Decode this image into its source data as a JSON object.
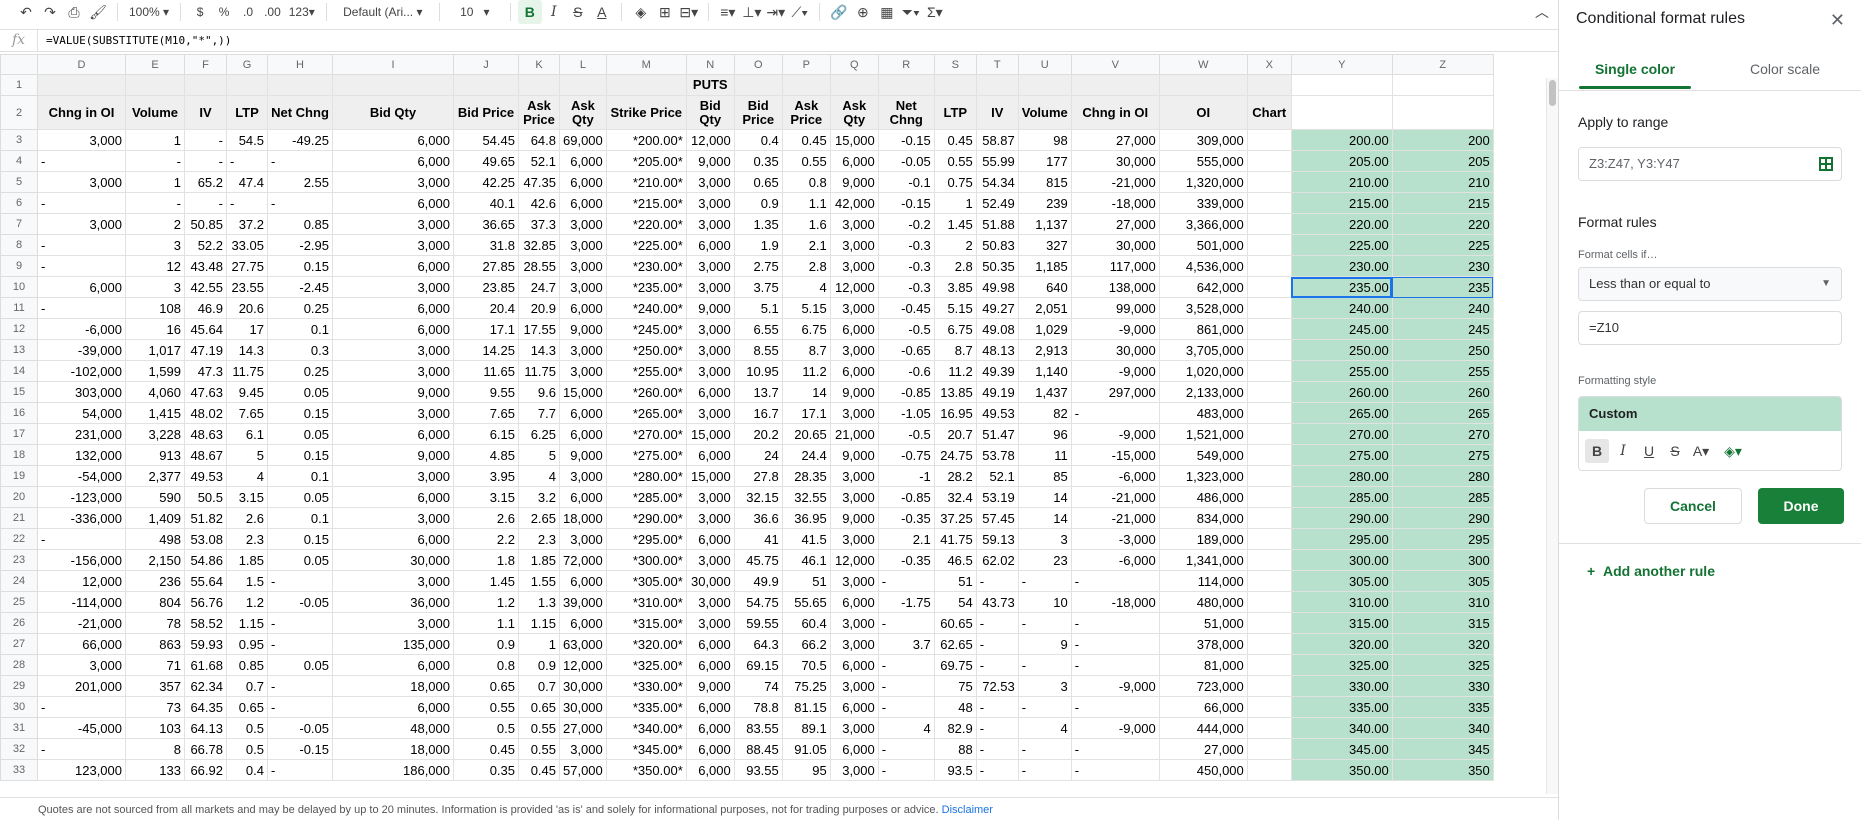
{
  "toolbar": {
    "zoom": "100%",
    "currency": "$",
    "percent": "%",
    "dec_less": ".0",
    "dec_more": ".00",
    "format_more": "123",
    "font": "Default (Ari...",
    "font_size": "10"
  },
  "formula": "=VALUE(SUBSTITUTE(M10,\"*\",))",
  "columns": [
    "D",
    "E",
    "F",
    "G",
    "H",
    "I",
    "J",
    "K",
    "L",
    "M",
    "N",
    "O",
    "P",
    "Q",
    "R",
    "S",
    "T",
    "U",
    "V",
    "W",
    "X",
    "Y",
    "Z"
  ],
  "puts_label": "PUTS",
  "headers": [
    "Chng in OI",
    "Volume",
    "IV",
    "LTP",
    "Net Chng",
    "Bid Qty",
    "Bid Price",
    "Ask Price",
    "Ask Qty",
    "Strike Price",
    "Bid Qty",
    "Bid Price",
    "Ask Price",
    "Ask Qty",
    "Net Chng",
    "LTP",
    "IV",
    "Volume",
    "Chng in OI",
    "OI",
    "Chart"
  ],
  "rows": [
    [
      "3",
      "3,000",
      "1",
      "-",
      "54.5",
      "-49.25",
      "6,000",
      "54.45",
      "64.8",
      "69,000",
      "*200.00*",
      "12,000",
      "0.4",
      "0.45",
      "15,000",
      "-0.15",
      "0.45",
      "58.87",
      "98",
      "27,000",
      "309,000",
      "",
      "200.00",
      "200"
    ],
    [
      "4",
      "-",
      "-",
      "-",
      "-",
      "-",
      "6,000",
      "49.65",
      "52.1",
      "6,000",
      "*205.00*",
      "9,000",
      "0.35",
      "0.55",
      "6,000",
      "-0.05",
      "0.55",
      "55.99",
      "177",
      "30,000",
      "555,000",
      "",
      "205.00",
      "205"
    ],
    [
      "5",
      "3,000",
      "1",
      "65.2",
      "47.4",
      "2.55",
      "3,000",
      "42.25",
      "47.35",
      "6,000",
      "*210.00*",
      "3,000",
      "0.65",
      "0.8",
      "9,000",
      "-0.1",
      "0.75",
      "54.34",
      "815",
      "-21,000",
      "1,320,000",
      "",
      "210.00",
      "210"
    ],
    [
      "6",
      "-",
      "-",
      "-",
      "-",
      "-",
      "6,000",
      "40.1",
      "42.6",
      "6,000",
      "*215.00*",
      "3,000",
      "0.9",
      "1.1",
      "42,000",
      "-0.15",
      "1",
      "52.49",
      "239",
      "-18,000",
      "339,000",
      "",
      "215.00",
      "215"
    ],
    [
      "7",
      "3,000",
      "2",
      "50.85",
      "37.2",
      "0.85",
      "3,000",
      "36.65",
      "37.3",
      "3,000",
      "*220.00*",
      "3,000",
      "1.35",
      "1.6",
      "3,000",
      "-0.2",
      "1.45",
      "51.88",
      "1,137",
      "27,000",
      "3,366,000",
      "",
      "220.00",
      "220"
    ],
    [
      "8",
      "-",
      "3",
      "52.2",
      "33.05",
      "-2.95",
      "3,000",
      "31.8",
      "32.85",
      "3,000",
      "*225.00*",
      "6,000",
      "1.9",
      "2.1",
      "3,000",
      "-0.3",
      "2",
      "50.83",
      "327",
      "30,000",
      "501,000",
      "",
      "225.00",
      "225"
    ],
    [
      "9",
      "-",
      "12",
      "43.48",
      "27.75",
      "0.15",
      "6,000",
      "27.85",
      "28.55",
      "3,000",
      "*230.00*",
      "3,000",
      "2.75",
      "2.8",
      "3,000",
      "-0.3",
      "2.8",
      "50.35",
      "1,185",
      "117,000",
      "4,536,000",
      "",
      "230.00",
      "230"
    ],
    [
      "10",
      "6,000",
      "3",
      "42.55",
      "23.55",
      "-2.45",
      "3,000",
      "23.85",
      "24.7",
      "3,000",
      "*235.00*",
      "3,000",
      "3.75",
      "4",
      "12,000",
      "-0.3",
      "3.85",
      "49.98",
      "640",
      "138,000",
      "642,000",
      "",
      "235.00",
      "235"
    ],
    [
      "11",
      "-",
      "108",
      "46.9",
      "20.6",
      "0.25",
      "6,000",
      "20.4",
      "20.9",
      "6,000",
      "*240.00*",
      "9,000",
      "5.1",
      "5.15",
      "3,000",
      "-0.45",
      "5.15",
      "49.27",
      "2,051",
      "99,000",
      "3,528,000",
      "",
      "240.00",
      "240"
    ],
    [
      "12",
      "-6,000",
      "16",
      "45.64",
      "17",
      "0.1",
      "6,000",
      "17.1",
      "17.55",
      "9,000",
      "*245.00*",
      "3,000",
      "6.55",
      "6.75",
      "6,000",
      "-0.5",
      "6.75",
      "49.08",
      "1,029",
      "-9,000",
      "861,000",
      "",
      "245.00",
      "245"
    ],
    [
      "13",
      "-39,000",
      "1,017",
      "47.19",
      "14.3",
      "0.3",
      "3,000",
      "14.25",
      "14.3",
      "3,000",
      "*250.00*",
      "3,000",
      "8.55",
      "8.7",
      "3,000",
      "-0.65",
      "8.7",
      "48.13",
      "2,913",
      "30,000",
      "3,705,000",
      "",
      "250.00",
      "250"
    ],
    [
      "14",
      "-102,000",
      "1,599",
      "47.3",
      "11.75",
      "0.25",
      "3,000",
      "11.65",
      "11.75",
      "3,000",
      "*255.00*",
      "3,000",
      "10.95",
      "11.2",
      "6,000",
      "-0.6",
      "11.2",
      "49.39",
      "1,140",
      "-9,000",
      "1,020,000",
      "",
      "255.00",
      "255"
    ],
    [
      "15",
      "303,000",
      "4,060",
      "47.63",
      "9.45",
      "0.05",
      "9,000",
      "9.55",
      "9.6",
      "15,000",
      "*260.00*",
      "6,000",
      "13.7",
      "14",
      "9,000",
      "-0.85",
      "13.85",
      "49.19",
      "1,437",
      "297,000",
      "2,133,000",
      "",
      "260.00",
      "260"
    ],
    [
      "16",
      "54,000",
      "1,415",
      "48.02",
      "7.65",
      "0.15",
      "3,000",
      "7.65",
      "7.7",
      "6,000",
      "*265.00*",
      "3,000",
      "16.7",
      "17.1",
      "3,000",
      "-1.05",
      "16.95",
      "49.53",
      "82",
      "-",
      "483,000",
      "",
      "265.00",
      "265"
    ],
    [
      "17",
      "231,000",
      "3,228",
      "48.63",
      "6.1",
      "0.05",
      "6,000",
      "6.15",
      "6.25",
      "6,000",
      "*270.00*",
      "15,000",
      "20.2",
      "20.65",
      "21,000",
      "-0.5",
      "20.7",
      "51.47",
      "96",
      "-9,000",
      "1,521,000",
      "",
      "270.00",
      "270"
    ],
    [
      "18",
      "132,000",
      "913",
      "48.67",
      "5",
      "0.15",
      "9,000",
      "4.85",
      "5",
      "9,000",
      "*275.00*",
      "6,000",
      "24",
      "24.4",
      "9,000",
      "-0.75",
      "24.75",
      "53.78",
      "11",
      "-15,000",
      "549,000",
      "",
      "275.00",
      "275"
    ],
    [
      "19",
      "-54,000",
      "2,377",
      "49.53",
      "4",
      "0.1",
      "3,000",
      "3.95",
      "4",
      "3,000",
      "*280.00*",
      "15,000",
      "27.8",
      "28.35",
      "3,000",
      "-1",
      "28.2",
      "52.1",
      "85",
      "-6,000",
      "1,323,000",
      "",
      "280.00",
      "280"
    ],
    [
      "20",
      "-123,000",
      "590",
      "50.5",
      "3.15",
      "0.05",
      "6,000",
      "3.15",
      "3.2",
      "6,000",
      "*285.00*",
      "3,000",
      "32.15",
      "32.55",
      "3,000",
      "-0.85",
      "32.4",
      "53.19",
      "14",
      "-21,000",
      "486,000",
      "",
      "285.00",
      "285"
    ],
    [
      "21",
      "-336,000",
      "1,409",
      "51.82",
      "2.6",
      "0.1",
      "3,000",
      "2.6",
      "2.65",
      "18,000",
      "*290.00*",
      "3,000",
      "36.6",
      "36.95",
      "9,000",
      "-0.35",
      "37.25",
      "57.45",
      "14",
      "-21,000",
      "834,000",
      "",
      "290.00",
      "290"
    ],
    [
      "22",
      "-",
      "498",
      "53.08",
      "2.3",
      "0.15",
      "6,000",
      "2.2",
      "2.3",
      "3,000",
      "*295.00*",
      "6,000",
      "41",
      "41.5",
      "3,000",
      "2.1",
      "41.75",
      "59.13",
      "3",
      "-3,000",
      "189,000",
      "",
      "295.00",
      "295"
    ],
    [
      "23",
      "-156,000",
      "2,150",
      "54.86",
      "1.85",
      "0.05",
      "30,000",
      "1.8",
      "1.85",
      "72,000",
      "*300.00*",
      "3,000",
      "45.75",
      "46.1",
      "12,000",
      "-0.35",
      "46.5",
      "62.02",
      "23",
      "-6,000",
      "1,341,000",
      "",
      "300.00",
      "300"
    ],
    [
      "24",
      "12,000",
      "236",
      "55.64",
      "1.5",
      "-",
      "3,000",
      "1.45",
      "1.55",
      "6,000",
      "*305.00*",
      "30,000",
      "49.9",
      "51",
      "3,000",
      "-",
      "51",
      "-",
      "-",
      "-",
      "114,000",
      "",
      "305.00",
      "305"
    ],
    [
      "25",
      "-114,000",
      "804",
      "56.76",
      "1.2",
      "-0.05",
      "36,000",
      "1.2",
      "1.3",
      "39,000",
      "*310.00*",
      "3,000",
      "54.75",
      "55.65",
      "6,000",
      "-1.75",
      "54",
      "43.73",
      "10",
      "-18,000",
      "480,000",
      "",
      "310.00",
      "310"
    ],
    [
      "26",
      "-21,000",
      "78",
      "58.52",
      "1.15",
      "-",
      "3,000",
      "1.1",
      "1.15",
      "6,000",
      "*315.00*",
      "3,000",
      "59.55",
      "60.4",
      "3,000",
      "-",
      "60.65",
      "-",
      "-",
      "-",
      "51,000",
      "",
      "315.00",
      "315"
    ],
    [
      "27",
      "66,000",
      "863",
      "59.93",
      "0.95",
      "-",
      "135,000",
      "0.9",
      "1",
      "63,000",
      "*320.00*",
      "6,000",
      "64.3",
      "66.2",
      "3,000",
      "3.7",
      "62.65",
      "-",
      "9",
      "-",
      "378,000",
      "",
      "320.00",
      "320"
    ],
    [
      "28",
      "3,000",
      "71",
      "61.68",
      "0.85",
      "0.05",
      "6,000",
      "0.8",
      "0.9",
      "12,000",
      "*325.00*",
      "6,000",
      "69.15",
      "70.5",
      "6,000",
      "-",
      "69.75",
      "-",
      "-",
      "-",
      "81,000",
      "",
      "325.00",
      "325"
    ],
    [
      "29",
      "201,000",
      "357",
      "62.34",
      "0.7",
      "-",
      "18,000",
      "0.65",
      "0.7",
      "30,000",
      "*330.00*",
      "9,000",
      "74",
      "75.25",
      "3,000",
      "-",
      "75",
      "72.53",
      "3",
      "-9,000",
      "723,000",
      "",
      "330.00",
      "330"
    ],
    [
      "30",
      "-",
      "73",
      "64.35",
      "0.65",
      "-",
      "6,000",
      "0.55",
      "0.65",
      "30,000",
      "*335.00*",
      "6,000",
      "78.8",
      "81.15",
      "6,000",
      "-",
      "48",
      "-",
      "-",
      "-",
      "66,000",
      "",
      "335.00",
      "335"
    ],
    [
      "31",
      "-45,000",
      "103",
      "64.13",
      "0.5",
      "-0.05",
      "48,000",
      "0.5",
      "0.55",
      "27,000",
      "*340.00*",
      "6,000",
      "83.55",
      "89.1",
      "3,000",
      "4",
      "82.9",
      "-",
      "4",
      "-9,000",
      "444,000",
      "",
      "340.00",
      "340"
    ],
    [
      "32",
      "-",
      "8",
      "66.78",
      "0.5",
      "-0.15",
      "18,000",
      "0.45",
      "0.55",
      "3,000",
      "*345.00*",
      "6,000",
      "88.45",
      "91.05",
      "6,000",
      "-",
      "88",
      "-",
      "-",
      "-",
      "27,000",
      "",
      "345.00",
      "345"
    ],
    [
      "33",
      "123,000",
      "133",
      "66.92",
      "0.4",
      "-",
      "186,000",
      "0.35",
      "0.45",
      "57,000",
      "*350.00*",
      "6,000",
      "93.55",
      "95",
      "3,000",
      "-",
      "93.5",
      "-",
      "-",
      "-",
      "450,000",
      "",
      "350.00",
      "350"
    ]
  ],
  "footer": {
    "text": "Quotes are not sourced from all markets and may be delayed by up to 20 minutes. Information is provided 'as is' and solely for informational purposes, not for trading purposes or advice.",
    "link": "Disclaimer"
  },
  "panel": {
    "title": "Conditional format rules",
    "tab_single": "Single color",
    "tab_scale": "Color scale",
    "apply_label": "Apply to range",
    "range": "Z3:Z47, Y3:Y47",
    "rules_label": "Format rules",
    "cells_if": "Format cells if…",
    "condition": "Less than or equal to",
    "value": "=Z10",
    "style_label": "Formatting style",
    "style_name": "Custom",
    "cancel": "Cancel",
    "done": "Done",
    "add_rule": "Add another rule"
  },
  "colors": {
    "highlight": "#b7e1cd",
    "accent": "#137333",
    "selection": "#1a73e8"
  }
}
